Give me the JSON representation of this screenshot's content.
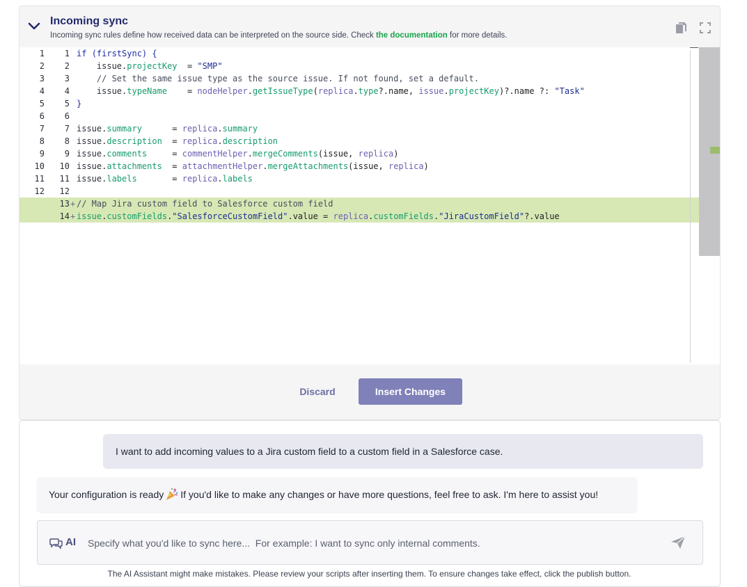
{
  "header": {
    "title": "Incoming sync",
    "subtitle_before": "Incoming sync rules define how received data can be interpreted on the source side. Check ",
    "doc_link": "the documentation",
    "subtitle_after": " for more details."
  },
  "editor": {
    "lines": [
      {
        "a": "1",
        "b": "1",
        "marker": ""
      },
      {
        "a": "2",
        "b": "2",
        "marker": ""
      },
      {
        "a": "3",
        "b": "3",
        "marker": ""
      },
      {
        "a": "4",
        "b": "4",
        "marker": ""
      },
      {
        "a": "5",
        "b": "5",
        "marker": ""
      },
      {
        "a": "6",
        "b": "6",
        "marker": ""
      },
      {
        "a": "7",
        "b": "7",
        "marker": ""
      },
      {
        "a": "8",
        "b": "8",
        "marker": ""
      },
      {
        "a": "9",
        "b": "9",
        "marker": ""
      },
      {
        "a": "10",
        "b": "10",
        "marker": ""
      },
      {
        "a": "11",
        "b": "11",
        "marker": ""
      },
      {
        "a": "12",
        "b": "12",
        "marker": ""
      },
      {
        "a": "",
        "b": "13",
        "marker": "+"
      },
      {
        "a": "",
        "b": "14",
        "marker": "+"
      }
    ],
    "code": [
      [
        [
          "kw",
          "if "
        ],
        [
          "kw",
          "(firstSync) {"
        ]
      ],
      [
        [
          "id",
          "    "
        ],
        [
          "id",
          "issue"
        ],
        [
          "dark",
          "."
        ],
        [
          "prop",
          "projectKey"
        ],
        [
          "dark",
          "  = "
        ],
        [
          "str",
          "\"SMP\""
        ]
      ],
      [
        [
          "cm",
          "    // Set the same issue type as the source issue. If not found, set a default."
        ]
      ],
      [
        [
          "id",
          "    "
        ],
        [
          "id",
          "issue"
        ],
        [
          "dark",
          "."
        ],
        [
          "prop",
          "typeName"
        ],
        [
          "dark",
          "    = "
        ],
        [
          "var",
          "nodeHelper"
        ],
        [
          "dark",
          "."
        ],
        [
          "prop",
          "getIssueType"
        ],
        [
          "dark",
          "("
        ],
        [
          "var",
          "replica"
        ],
        [
          "dark",
          "."
        ],
        [
          "prop",
          "type"
        ],
        [
          "dark",
          "?.name, "
        ],
        [
          "var",
          "issue"
        ],
        [
          "dark",
          "."
        ],
        [
          "prop",
          "projectKey"
        ],
        [
          "dark",
          ")?.name ?: "
        ],
        [
          "str",
          "\"Task\""
        ]
      ],
      [
        [
          "kw",
          "}"
        ]
      ],
      [],
      [
        [
          "id",
          "issue"
        ],
        [
          "dark",
          "."
        ],
        [
          "prop",
          "summary"
        ],
        [
          "dark",
          "      = "
        ],
        [
          "var",
          "replica"
        ],
        [
          "dark",
          "."
        ],
        [
          "prop",
          "summary"
        ]
      ],
      [
        [
          "id",
          "issue"
        ],
        [
          "dark",
          "."
        ],
        [
          "prop",
          "description"
        ],
        [
          "dark",
          "  = "
        ],
        [
          "var",
          "replica"
        ],
        [
          "dark",
          "."
        ],
        [
          "prop",
          "description"
        ]
      ],
      [
        [
          "id",
          "issue"
        ],
        [
          "dark",
          "."
        ],
        [
          "prop",
          "comments"
        ],
        [
          "dark",
          "     = "
        ],
        [
          "var",
          "commentHelper"
        ],
        [
          "dark",
          "."
        ],
        [
          "prop",
          "mergeComments"
        ],
        [
          "dark",
          "(issue, "
        ],
        [
          "var",
          "replica"
        ],
        [
          "dark",
          ")"
        ]
      ],
      [
        [
          "id",
          "issue"
        ],
        [
          "dark",
          "."
        ],
        [
          "prop",
          "attachments"
        ],
        [
          "dark",
          "  = "
        ],
        [
          "var",
          "attachmentHelper"
        ],
        [
          "dark",
          "."
        ],
        [
          "prop",
          "mergeAttachments"
        ],
        [
          "dark",
          "(issue, "
        ],
        [
          "var",
          "replica"
        ],
        [
          "dark",
          ")"
        ]
      ],
      [
        [
          "id",
          "issue"
        ],
        [
          "dark",
          "."
        ],
        [
          "prop",
          "labels"
        ],
        [
          "dark",
          "       = "
        ],
        [
          "var",
          "replica"
        ],
        [
          "dark",
          "."
        ],
        [
          "prop",
          "labels"
        ]
      ],
      [],
      [
        [
          "cm",
          "// Map Jira custom field to Salesforce custom field"
        ]
      ],
      [
        [
          "prop",
          "issue"
        ],
        [
          "dark",
          "."
        ],
        [
          "prop",
          "customFields"
        ],
        [
          "dark",
          "."
        ],
        [
          "str",
          "\"SalesforceCustomField\""
        ],
        [
          "dark",
          ".value = "
        ],
        [
          "var",
          "replica"
        ],
        [
          "dark",
          "."
        ],
        [
          "prop",
          "customFields"
        ],
        [
          "dark",
          "."
        ],
        [
          "str",
          "\"JiraCustomField\""
        ],
        [
          "dark",
          "?.value"
        ]
      ]
    ]
  },
  "actions": {
    "discard_label": "Discard",
    "insert_label": "Insert Changes"
  },
  "chat": {
    "user_message": "I want to add incoming values to a Jira custom field to a custom field in a Salesforce case.",
    "bot_before_icon": "Your configuration is ready",
    "bot_icon": "party-popper-icon",
    "bot_after_icon": "If you'd like to make any changes or have more questions, feel free to ask. I'm here to assist you!",
    "ai_label": "AI",
    "input_placeholder": "Specify what you'd like to sync here...  For example: I want to sync only internal comments.",
    "input_value": ""
  },
  "disclaimer": "The AI Assistant might make mistakes. Please review your scripts after inserting them. To ensure changes take effect, click the publish button.",
  "colors": {
    "accent": "#7f81b8",
    "title": "#232a6b",
    "link": "#18a34a",
    "added_line": "#d7e8b5"
  }
}
